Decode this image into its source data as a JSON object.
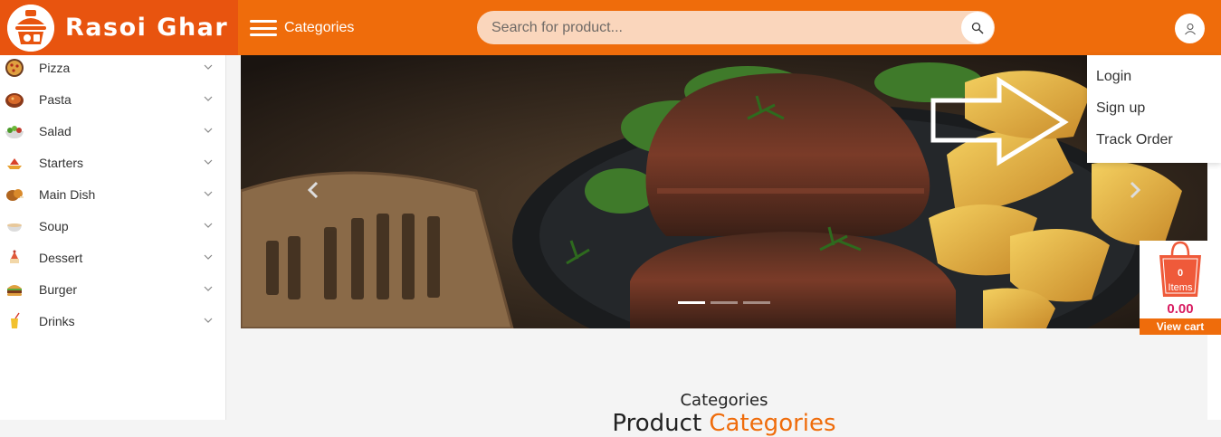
{
  "brand": {
    "name": "Rasoi Ghar"
  },
  "header": {
    "categories_label": "Categories",
    "search_placeholder": "Search for product..."
  },
  "sidebar": {
    "items": [
      {
        "label": "Pizza",
        "icon": "pizza-icon"
      },
      {
        "label": "Pasta",
        "icon": "pasta-icon"
      },
      {
        "label": "Salad",
        "icon": "salad-icon"
      },
      {
        "label": "Starters",
        "icon": "starters-icon"
      },
      {
        "label": "Main Dish",
        "icon": "main-dish-icon"
      },
      {
        "label": "Soup",
        "icon": "soup-icon"
      },
      {
        "label": "Dessert",
        "icon": "dessert-icon"
      },
      {
        "label": "Burger",
        "icon": "burger-icon"
      },
      {
        "label": "Drinks",
        "icon": "drinks-icon"
      }
    ]
  },
  "user_menu": {
    "items": [
      "Login",
      "Sign up",
      "Track Order"
    ]
  },
  "carousel": {
    "slide_count": 3,
    "active_slide": 1
  },
  "cart": {
    "count": "0",
    "items_label": "Items",
    "amount": "0.00",
    "view_label": "View cart"
  },
  "section": {
    "caption": "Categories",
    "title_prefix": "Product ",
    "title_highlight": "Categories"
  },
  "colors": {
    "accent": "#ef6c0b",
    "brand_bg": "#e8540f",
    "search_bg": "#fad6bc",
    "cart_amount": "#d81b60"
  }
}
